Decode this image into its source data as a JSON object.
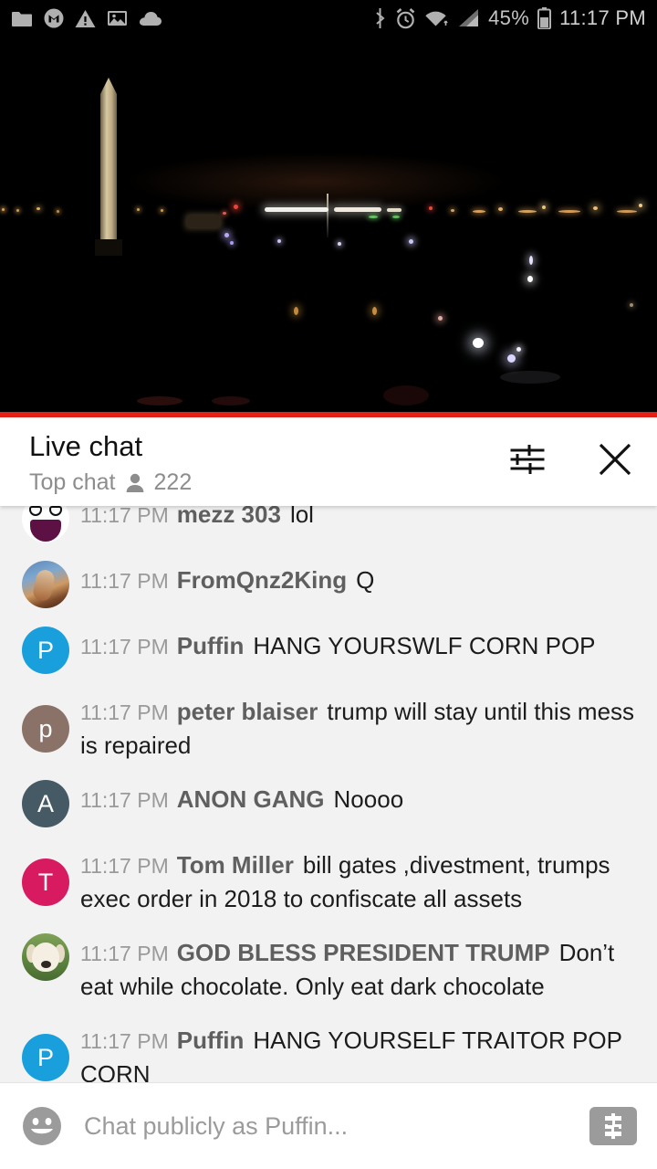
{
  "statusbar": {
    "left_icons": [
      "folder-icon",
      "gmail-icon",
      "warning-icon",
      "image-icon",
      "cloud-icon"
    ],
    "right_icons": [
      "bluetooth-icon",
      "alarm-icon",
      "wifi-icon",
      "signal-icon",
      "battery-icon"
    ],
    "battery_percent": "45%",
    "time": "11:17 PM"
  },
  "video": {
    "scene": "washington-monument-night",
    "progress_color": "#e52117"
  },
  "chat_header": {
    "title": "Live chat",
    "mode": "Top chat",
    "viewer_icon": "person-icon",
    "viewer_count": "222",
    "tune_icon": "tune-icon",
    "close_icon": "close-icon"
  },
  "messages": [
    {
      "time": "11:17 PM",
      "author": "mezz 303",
      "text": "lol",
      "avatar_type": "meme",
      "avatar_initial": "",
      "avatar_color": "#ffffff"
    },
    {
      "time": "11:17 PM",
      "author": "FromQnz2King",
      "text": "Q",
      "avatar_type": "paint",
      "avatar_initial": "",
      "avatar_color": "#5a86b8"
    },
    {
      "time": "11:17 PM",
      "author": "Puffin",
      "text": "HANG YOURSWLF CORN POP",
      "avatar_type": "letter",
      "avatar_initial": "P",
      "avatar_color": "#1a9fdd"
    },
    {
      "time": "11:17 PM",
      "author": "peter blaiser",
      "text": "trump will stay until this mess is repaired",
      "avatar_type": "letter",
      "avatar_initial": "p",
      "avatar_color": "#8a7268"
    },
    {
      "time": "11:17 PM",
      "author": "ANON GANG",
      "text": "Noooo",
      "avatar_type": "letter",
      "avatar_initial": "A",
      "avatar_color": "#455a64"
    },
    {
      "time": "11:17 PM",
      "author": "Tom Miller",
      "text": "bill gates ,divestment, trumps exec order in 2018 to confiscate all assets",
      "avatar_type": "letter",
      "avatar_initial": "T",
      "avatar_color": "#d81b60"
    },
    {
      "time": "11:17 PM",
      "author": "GOD BLESS PRESIDENT TRUMP",
      "text": "Don’t eat while chocolate. Only eat dark chocolate",
      "avatar_type": "dog",
      "avatar_initial": "",
      "avatar_color": "#6e9450"
    },
    {
      "time": "11:17 PM",
      "author": "Puffin",
      "text": "HANG YOURSELF TRAITOR POP CORN",
      "avatar_type": "letter",
      "avatar_initial": "P",
      "avatar_color": "#1a9fdd"
    }
  ],
  "input_bar": {
    "emoji_icon": "emoji-smiley-icon",
    "placeholder": "Chat publicly as Puffin...",
    "value": "",
    "superchat_icon": "dollar-icon"
  }
}
